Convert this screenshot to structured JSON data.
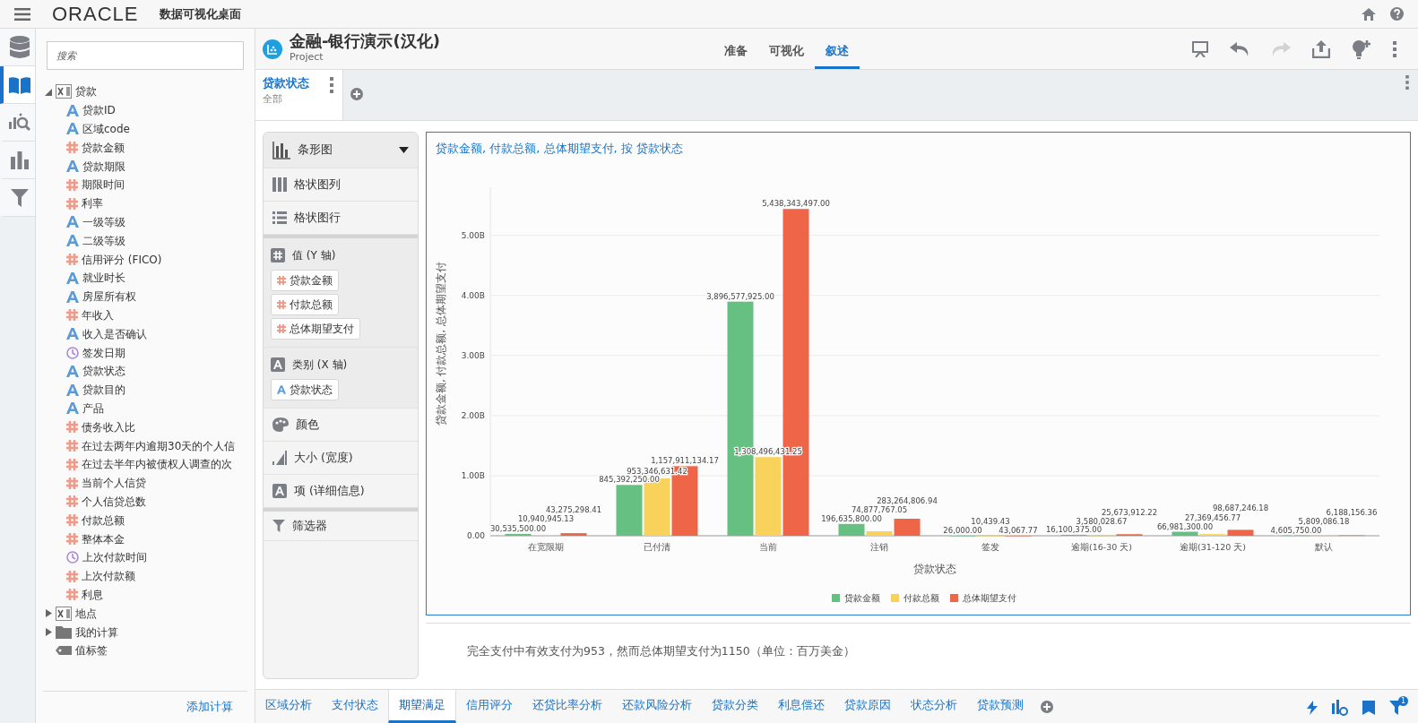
{
  "app": {
    "logo": "ORACLE",
    "title": "数据可视化桌面"
  },
  "rail": [
    {
      "kind": "data",
      "selected": false
    },
    {
      "kind": "book",
      "selected": true
    },
    {
      "kind": "analyze",
      "selected": false
    },
    {
      "kind": "chart",
      "selected": false
    },
    {
      "kind": "filter",
      "selected": false
    }
  ],
  "search": {
    "placeholder": "搜索"
  },
  "tree": [
    {
      "label": "贷款",
      "kind": "table",
      "expanded": true,
      "children": [
        {
          "label": "贷款ID",
          "kind": "text"
        },
        {
          "label": "区域code",
          "kind": "text"
        },
        {
          "label": "贷款金额",
          "kind": "number"
        },
        {
          "label": "贷款期限",
          "kind": "text"
        },
        {
          "label": "期限时间",
          "kind": "number"
        },
        {
          "label": "利率",
          "kind": "number"
        },
        {
          "label": "一级等级",
          "kind": "text"
        },
        {
          "label": "二级等级",
          "kind": "text"
        },
        {
          "label": "信用评分 (FICO)",
          "kind": "number"
        },
        {
          "label": "就业时长",
          "kind": "text"
        },
        {
          "label": "房屋所有权",
          "kind": "text"
        },
        {
          "label": "年收入",
          "kind": "number"
        },
        {
          "label": "收入是否确认",
          "kind": "text"
        },
        {
          "label": "签发日期",
          "kind": "time"
        },
        {
          "label": "贷款状态",
          "kind": "text"
        },
        {
          "label": "贷款目的",
          "kind": "text"
        },
        {
          "label": "产品",
          "kind": "text"
        },
        {
          "label": "债务收入比",
          "kind": "number"
        },
        {
          "label": "在过去两年内逾期30天的个人信",
          "kind": "number"
        },
        {
          "label": "在过去半年内被债权人调查的次",
          "kind": "number"
        },
        {
          "label": "当前个人信贷",
          "kind": "number"
        },
        {
          "label": "个人信贷总数",
          "kind": "number"
        },
        {
          "label": "付款总额",
          "kind": "number"
        },
        {
          "label": "整体本金",
          "kind": "number"
        },
        {
          "label": "上次付款时间",
          "kind": "time"
        },
        {
          "label": "上次付款额",
          "kind": "number"
        },
        {
          "label": "利息",
          "kind": "number"
        }
      ]
    },
    {
      "label": "地点",
      "kind": "table",
      "expanded": false
    },
    {
      "label": "我的计算",
      "kind": "folder",
      "expanded": false
    },
    {
      "label": "值标签",
      "kind": "tag"
    }
  ],
  "add_calc": "添加计算",
  "project": {
    "title": "金融-银行演示(汉化)",
    "subtitle": "Project"
  },
  "modes": [
    {
      "label": "准备",
      "selected": false
    },
    {
      "label": "可视化",
      "selected": false
    },
    {
      "label": "叙述",
      "selected": true
    }
  ],
  "toolbar": [
    {
      "kind": "present",
      "disabled": false
    },
    {
      "kind": "undo",
      "disabled": false
    },
    {
      "kind": "redo",
      "disabled": true
    },
    {
      "kind": "share",
      "disabled": false
    },
    {
      "kind": "insight",
      "disabled": false
    },
    {
      "kind": "more",
      "disabled": false
    }
  ],
  "canvas_tabs": [
    {
      "title": "贷款状态",
      "subtitle": "全部",
      "selected": true
    }
  ],
  "grammar": {
    "chart_type": "条形图",
    "trellis": [
      {
        "kind": "columns",
        "label": "格状图列"
      },
      {
        "kind": "rows",
        "label": "格状图行"
      }
    ],
    "sections": [
      {
        "kind": "number",
        "label": "值 (Y 轴)",
        "pills": [
          {
            "kind": "number",
            "label": "贷款金额"
          },
          {
            "kind": "number",
            "label": "付款总额"
          },
          {
            "kind": "number",
            "label": "总体期望支付"
          }
        ]
      },
      {
        "kind": "text",
        "label": "类别 (X 轴)",
        "pills": [
          {
            "kind": "text",
            "label": "贷款状态"
          }
        ]
      }
    ],
    "extras": [
      {
        "kind": "color",
        "label": "颜色"
      },
      {
        "kind": "size",
        "label": "大小 (宽度)"
      },
      {
        "kind": "detail",
        "label": "项 (详细信息)"
      }
    ],
    "filter": "筛选器"
  },
  "visual": {
    "title": "贷款金额, 付款总额, 总体期望支付, 按 贷款状态",
    "selected": true,
    "chart_data": {
      "type": "bar",
      "xlabel": "贷款状态",
      "ylabel": "贷款金额, 付款总额, 总体期望支付",
      "categories": [
        "在宽限期",
        "已付清",
        "当前",
        "注销",
        "签发",
        "逾期(16-30 天)",
        "逾期(31-120 天)",
        "默认"
      ],
      "series": [
        {
          "name": "贷款金额",
          "color": "#66c082",
          "values": [
            30535500,
            845392250,
            3896577925,
            196635800,
            26000,
            16100375,
            66981300,
            4605750
          ],
          "value_labels": [
            "30,535,500.00",
            "845,392,250.00",
            "3,896,577,925.00",
            "196,635,800.00",
            "26,000.00",
            "16,100,375.00",
            "66,981,300.00",
            "4,605,750.00"
          ]
        },
        {
          "name": "付款总额",
          "color": "#f8d25a",
          "values": [
            10940945.13,
            953346631.42,
            1308496431.25,
            74877767.05,
            10439.43,
            3580028.67,
            27369456.77,
            5809086.18
          ],
          "value_labels": [
            "10,940,945.13",
            "953,346,631.42",
            "1,308,496,431.25",
            "74,877,767.05",
            "10,439.43",
            "3,580,028.67",
            "27,369,456.77",
            "5,809,086.18"
          ]
        },
        {
          "name": "总体期望支付",
          "color": "#ee6547",
          "values": [
            43275298.41,
            1157911134.17,
            5438343497,
            283264806.94,
            43067.77,
            25673912.22,
            98687246.18,
            6188156.36
          ],
          "value_labels": [
            "43,275,298.41",
            "1,157,911,134.17",
            "5,438,343,497.00",
            "283,264,806.94",
            "43,067.77",
            "25,673,912.22",
            "98,687,246.18",
            "6,188,156.36"
          ]
        }
      ],
      "grid": true,
      "legend": "bottom",
      "ylim": [
        0,
        5800000000
      ],
      "yticks": [
        {
          "value": 0,
          "label": "0.00"
        },
        {
          "value": 1000000000,
          "label": "1.00B"
        },
        {
          "value": 2000000000,
          "label": "2.00B"
        },
        {
          "value": 3000000000,
          "label": "3.00B"
        },
        {
          "value": 4000000000,
          "label": "4.00B"
        },
        {
          "value": 5000000000,
          "label": "5.00B"
        }
      ],
      "data_labels": true
    }
  },
  "note": "完全支付中有效支付为953，然而总体期望支付为1150（单位：百万美金）",
  "pages": [
    {
      "label": "区域分析",
      "selected": false
    },
    {
      "label": "支付状态",
      "selected": false
    },
    {
      "label": "期望满足",
      "selected": true
    },
    {
      "label": "信用评分",
      "selected": false
    },
    {
      "label": "还贷比率分析",
      "selected": false
    },
    {
      "label": "还款风险分析",
      "selected": false
    },
    {
      "label": "贷款分类",
      "selected": false
    },
    {
      "label": "利息偿还",
      "selected": false
    },
    {
      "label": "贷款原因",
      "selected": false
    },
    {
      "label": "状态分析",
      "selected": false
    },
    {
      "label": "贷款预测",
      "selected": false
    }
  ],
  "filter_count": "1"
}
